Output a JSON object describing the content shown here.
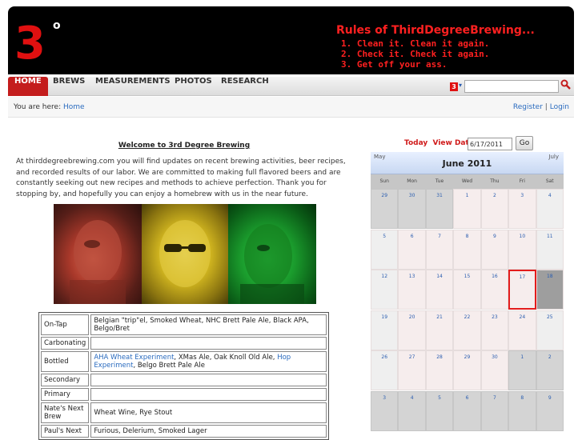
{
  "header": {
    "logo_text": "3",
    "logo_degree": "o",
    "rules_title": "Rules of ThirdDegreeBrewing...",
    "rules": [
      "1. Clean it.  Clean it again.",
      "2. Check it.  Check it again.",
      "3. Get off your ass."
    ]
  },
  "nav": {
    "items": [
      "HOME",
      "BREWS",
      "MEASUREMENTS",
      "PHOTOS",
      "RESEARCH"
    ],
    "search_logo": "3",
    "search_caret": "▾",
    "search_value": ""
  },
  "breadcrumb": {
    "lead": "You are here:",
    "home": "Home",
    "register": "Register",
    "sep": "|",
    "login": "Login"
  },
  "main": {
    "welcome": "Welcome to 3rd Degree Brewing",
    "intro": "At thirddegreebrewing.com you will find updates on recent brewing activities, beer recipes, and recorded results of our labor.  We are committed to making full flavored beers and are constantly seeking out new recipes and methods to achieve perfection.  Thank you for stopping by, and hopefully you can enjoy a homebrew with us in the near future."
  },
  "ontap_table": [
    {
      "label": "On-Tap",
      "value": "Belgian \"trip\"el, Smoked Wheat, NHC Brett Pale Ale, Black APA, Belgo/Bret"
    },
    {
      "label": "Carbonating",
      "value": ""
    },
    {
      "label": "Bottled",
      "link1": "AHA Wheat Experiment",
      "mid": ", XMas Ale, Oak Knoll Old Ale, ",
      "link2": "Hop Experiment",
      "tail": ", Belgo Brett Pale Ale"
    },
    {
      "label": "Secondary",
      "value": ""
    },
    {
      "label": "Primary",
      "value": ""
    },
    {
      "label": "Nate's Next Brew",
      "value": "Wheat Wine, Rye Stout"
    },
    {
      "label": "Paul's Next",
      "value": "Furious, Delerium, Smoked Lager"
    }
  ],
  "calendar": {
    "today_label": "Today",
    "view_label": "View Date:",
    "date_value": "6/17/2011",
    "go_label": "Go",
    "prev_month": "May",
    "next_month": "July",
    "title": "June 2011",
    "dows": [
      "Sun",
      "Mon",
      "Tue",
      "Wed",
      "Thu",
      "Fri",
      "Sat"
    ],
    "weeks": [
      [
        "29",
        "30",
        "31",
        "1",
        "2",
        "3",
        "4"
      ],
      [
        "5",
        "6",
        "7",
        "8",
        "9",
        "10",
        "11"
      ],
      [
        "12",
        "13",
        "14",
        "15",
        "16",
        "17",
        "18"
      ],
      [
        "19",
        "20",
        "21",
        "22",
        "23",
        "24",
        "25"
      ],
      [
        "26",
        "27",
        "28",
        "29",
        "30",
        "1",
        "2"
      ],
      [
        "3",
        "4",
        "5",
        "6",
        "7",
        "8",
        "9"
      ]
    ]
  }
}
